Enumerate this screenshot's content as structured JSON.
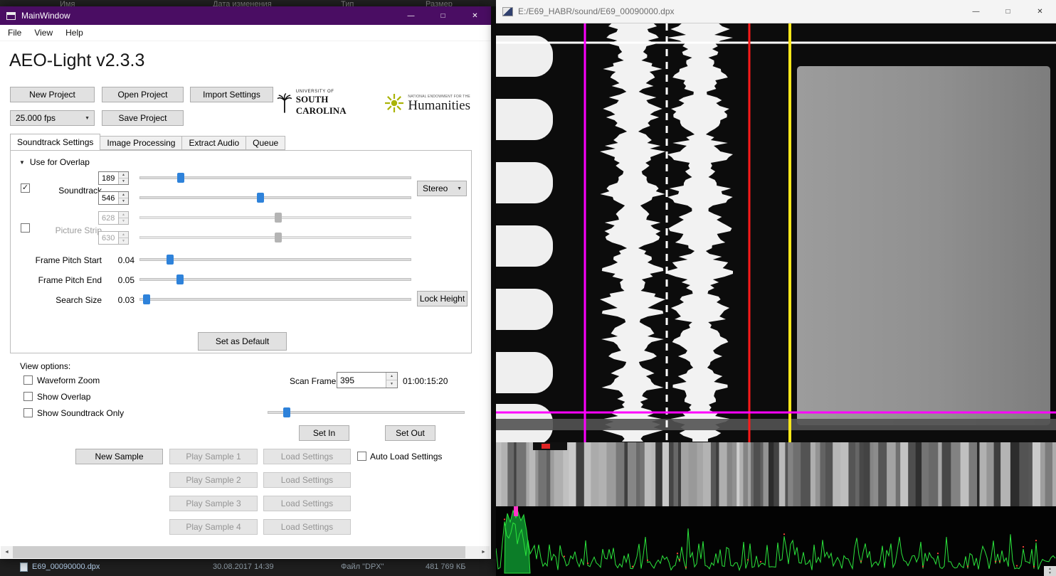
{
  "explorer": {
    "columns": [
      "Имя",
      "Дата изменения",
      "Тип",
      "Размер"
    ],
    "file_row": {
      "name": "E69_00090000.dpx",
      "date": "30.08.2017 14:39",
      "type": "Файл \"DPX\"",
      "size": "481 769 КБ"
    }
  },
  "main_window": {
    "title": "MainWindow",
    "menu": [
      "File",
      "View",
      "Help"
    ],
    "app_title": "AEO-Light v2.3.3",
    "toolbar": {
      "new_project": "New Project",
      "open_project": "Open Project",
      "import_settings": "Import Settings",
      "fps_combo": "25.000 fps",
      "save_project": "Save Project"
    },
    "logos": {
      "usc_line1": "UNIVERSITY OF",
      "usc_line2": "SOUTH CAROLINA",
      "neh_line1": "NATIONAL ENDOWMENT FOR THE",
      "neh_line2": "Humanities"
    },
    "tabs": [
      "Soundtrack Settings",
      "Image Processing",
      "Extract Audio",
      "Queue"
    ],
    "soundtrack_tab": {
      "overlap_toggle": "Use for Overlap",
      "soundtrack_label": "Soundtrack",
      "soundtrack_left": "189",
      "soundtrack_right": "546",
      "channel_mode": "Stereo",
      "picture_label": "Picture Strip",
      "picture_left": "628",
      "picture_right": "630",
      "frame_pitch_start_label": "Frame Pitch Start",
      "frame_pitch_start_value": "0.04",
      "frame_pitch_end_label": "Frame Pitch End",
      "frame_pitch_end_value": "0.05",
      "search_size_label": "Search Size",
      "search_size_value": "0.03",
      "lock_height": "Lock Height",
      "set_as_default": "Set as Default"
    },
    "view_options": {
      "heading": "View options:",
      "waveform_zoom": "Waveform Zoom",
      "show_overlap": "Show Overlap",
      "show_soundtrack_only": "Show Soundtrack Only"
    },
    "scan": {
      "label": "Scan Frame:",
      "frame": "395",
      "timecode": "01:00:15:20",
      "set_in": "Set In",
      "set_out": "Set Out"
    },
    "samples": {
      "new_sample": "New Sample",
      "play_samples": [
        "Play Sample 1",
        "Play Sample 2",
        "Play Sample 3",
        "Play Sample 4"
      ],
      "load_settings": "Load Settings",
      "auto_load_settings": "Auto Load Settings"
    }
  },
  "viewer_window": {
    "title": "E:/E69_HABR/sound/E69_00090000.dpx",
    "overlay_colors": {
      "left_bound": "#ff00ff",
      "center_dashed": "#ffffff",
      "right_bound": "#ff1a1a",
      "picture_bound": "#ffe81a",
      "frame_line": "#ff00ff"
    }
  },
  "icons": {
    "minimize": "—",
    "maximize": "□",
    "close": "✕",
    "combo_arrow": "▼",
    "spin_up": "▲",
    "spin_down": "▼",
    "collapse_arrow": "▼",
    "check": "✓",
    "scroll_left": "◄",
    "scroll_right": "►",
    "scroll_up": "▲",
    "scroll_down": "▼"
  },
  "colors": {
    "titlebar_purple": "#4a0d63",
    "slider_handle_blue": "#2e82da",
    "waveform_green": "#2be43c"
  }
}
